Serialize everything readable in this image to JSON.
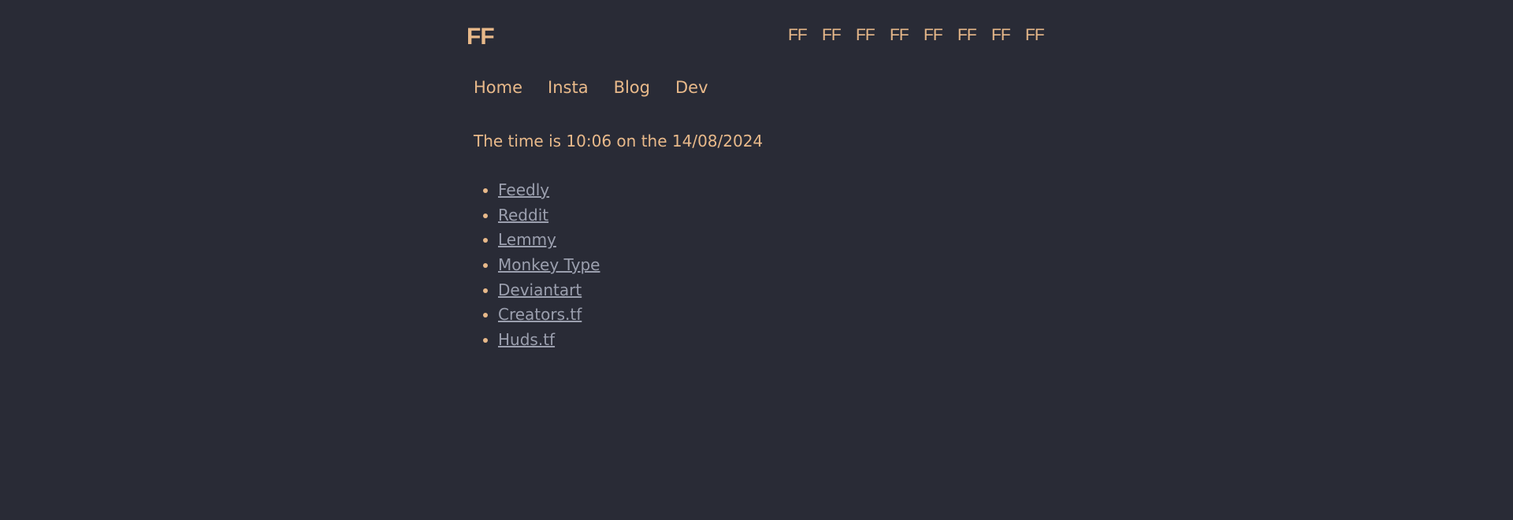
{
  "header": {
    "logo_text": "FF",
    "mini_logo_count": 8,
    "mini_logo_text": "FF"
  },
  "nav": {
    "items": [
      {
        "label": "Home"
      },
      {
        "label": "Insta"
      },
      {
        "label": "Blog"
      },
      {
        "label": "Dev"
      }
    ]
  },
  "status": {
    "time_text": "The time is 10:06 on the 14/08/2024"
  },
  "links": [
    {
      "label": "Feedly"
    },
    {
      "label": "Reddit"
    },
    {
      "label": "Lemmy"
    },
    {
      "label": "Monkey Type"
    },
    {
      "label": "Deviantart"
    },
    {
      "label": "Creators.tf"
    },
    {
      "label": "Huds.tf"
    }
  ],
  "colors": {
    "background": "#292b36",
    "accent": "#e8b98a",
    "link": "#9b9fae"
  }
}
